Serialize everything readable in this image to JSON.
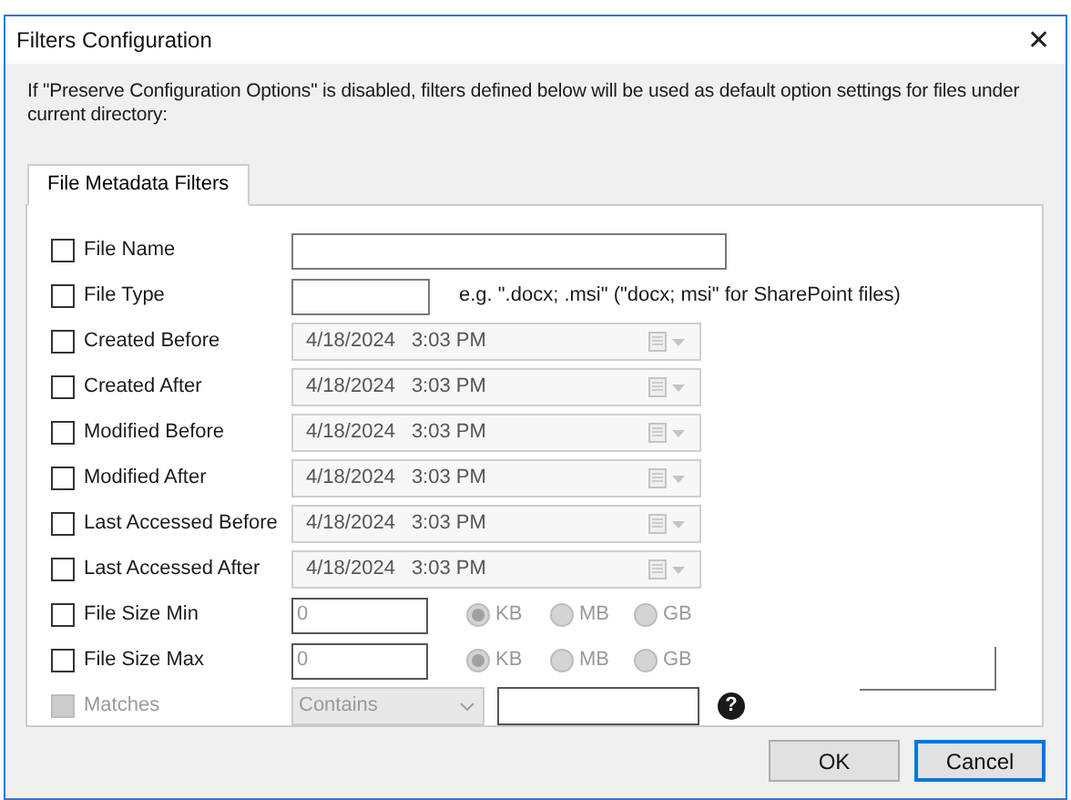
{
  "window": {
    "title": "Filters Configuration",
    "close": "✕"
  },
  "intro": "If \"Preserve Configuration Options\" is disabled, filters defined below will be used as default option settings for files under current directory:",
  "tabs": [
    {
      "label": "File Metadata Filters",
      "selected": true
    }
  ],
  "filters": [
    {
      "kind": "text",
      "label": "File Name",
      "checked": false,
      "disabled": false,
      "wide": true
    },
    {
      "kind": "text",
      "label": "File Type",
      "checked": false,
      "disabled": false,
      "wide": false,
      "hint": "e.g. \".docx; .msi\" (\"docx; msi\" for SharePoint files)"
    },
    {
      "kind": "date",
      "label": "Created Before",
      "checked": false,
      "disabled": false,
      "date": "4/18/2024",
      "time": "3:03 PM"
    },
    {
      "kind": "date",
      "label": "Created After",
      "checked": false,
      "disabled": false,
      "date": "4/18/2024",
      "time": "3:03 PM"
    },
    {
      "kind": "date",
      "label": "Modified Before",
      "checked": false,
      "disabled": false,
      "date": "4/18/2024",
      "time": "3:03 PM"
    },
    {
      "kind": "date",
      "label": "Modified After",
      "checked": false,
      "disabled": false,
      "date": "4/18/2024",
      "time": "3:03 PM"
    },
    {
      "kind": "date",
      "label": "Last Accessed Before",
      "checked": false,
      "disabled": false,
      "date": "4/18/2024",
      "time": "3:03 PM"
    },
    {
      "kind": "date",
      "label": "Last Accessed After",
      "checked": false,
      "disabled": false,
      "date": "4/18/2024",
      "time": "3:03 PM"
    },
    {
      "kind": "size",
      "label": "File Size Min",
      "checked": false,
      "disabled": false,
      "value": "0",
      "units": [
        {
          "label": "KB",
          "selected": true
        },
        {
          "label": "MB",
          "selected": false
        },
        {
          "label": "GB",
          "selected": false
        }
      ]
    },
    {
      "kind": "size",
      "label": "File Size Max",
      "checked": false,
      "disabled": false,
      "value": "0",
      "units": [
        {
          "label": "KB",
          "selected": true
        },
        {
          "label": "MB",
          "selected": false
        },
        {
          "label": "GB",
          "selected": false
        }
      ]
    },
    {
      "kind": "match",
      "label": "Matches",
      "checked": false,
      "disabled": true,
      "mode": "Contains",
      "help": "?"
    }
  ],
  "buttons": [
    {
      "label": "OK",
      "default": false
    },
    {
      "label": "Cancel",
      "default": true
    }
  ]
}
